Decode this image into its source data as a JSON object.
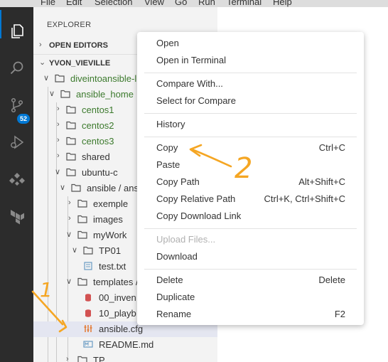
{
  "menubar": [
    "File",
    "Edit",
    "Selection",
    "View",
    "Go",
    "Run",
    "Terminal",
    "Help"
  ],
  "activity": {
    "items": [
      "explorer-icon",
      "search-icon",
      "source-control-icon",
      "run-debug-icon",
      "remote-explorer-icon",
      "terraform-icon"
    ],
    "source_control_badge": "52",
    "accent": "#0078d4"
  },
  "sidebar": {
    "title": "EXPLORER",
    "open_editors": "OPEN EDITORS",
    "workspace": "YVON_VIEVILLE",
    "tree": [
      {
        "label": "diveintoansible-l",
        "color": "#3c7a2d"
      },
      {
        "label": "ansible_home",
        "color": "#3c7a2d"
      },
      {
        "label": "centos1",
        "color": "#3c7a2d"
      },
      {
        "label": "centos2",
        "color": "#3c7a2d"
      },
      {
        "label": "centos3",
        "color": "#3c7a2d"
      },
      {
        "label": "shared",
        "color": "#333333"
      },
      {
        "label": "ubuntu-c",
        "color": "#333333"
      },
      {
        "label": "ansible / ans",
        "color": "#333333"
      },
      {
        "label": "exemple",
        "color": "#333333"
      },
      {
        "label": "images",
        "color": "#333333"
      },
      {
        "label": "myWork",
        "color": "#333333"
      },
      {
        "label": "TP01",
        "color": "#333333"
      },
      {
        "label": "test.txt",
        "color": "#333333"
      },
      {
        "label": "templates /",
        "color": "#333333"
      },
      {
        "label": "00_inven",
        "color": "#333333"
      },
      {
        "label": "10_playb",
        "color": "#333333"
      },
      {
        "label": "ansible.cfg",
        "color": "#333333"
      },
      {
        "label": "README.md",
        "color": "#333333"
      },
      {
        "label": "TP",
        "color": "#333333"
      }
    ]
  },
  "context_menu": {
    "open": "Open",
    "open_in_terminal": "Open in Terminal",
    "compare_with": "Compare With...",
    "select_for_compare": "Select for Compare",
    "history": "History",
    "copy": "Copy",
    "copy_key": "Ctrl+C",
    "paste": "Paste",
    "copy_path": "Copy Path",
    "copy_path_key": "Alt+Shift+C",
    "copy_relative_path": "Copy Relative Path",
    "copy_relative_path_key": "Ctrl+K, Ctrl+Shift+C",
    "copy_download_link": "Copy Download Link",
    "upload_files": "Upload Files...",
    "download": "Download",
    "delete": "Delete",
    "delete_key": "Delete",
    "duplicate": "Duplicate",
    "rename": "Rename",
    "rename_key": "F2"
  },
  "annotations": {
    "step1": "1",
    "step2": "2",
    "color": "#f5a623"
  }
}
